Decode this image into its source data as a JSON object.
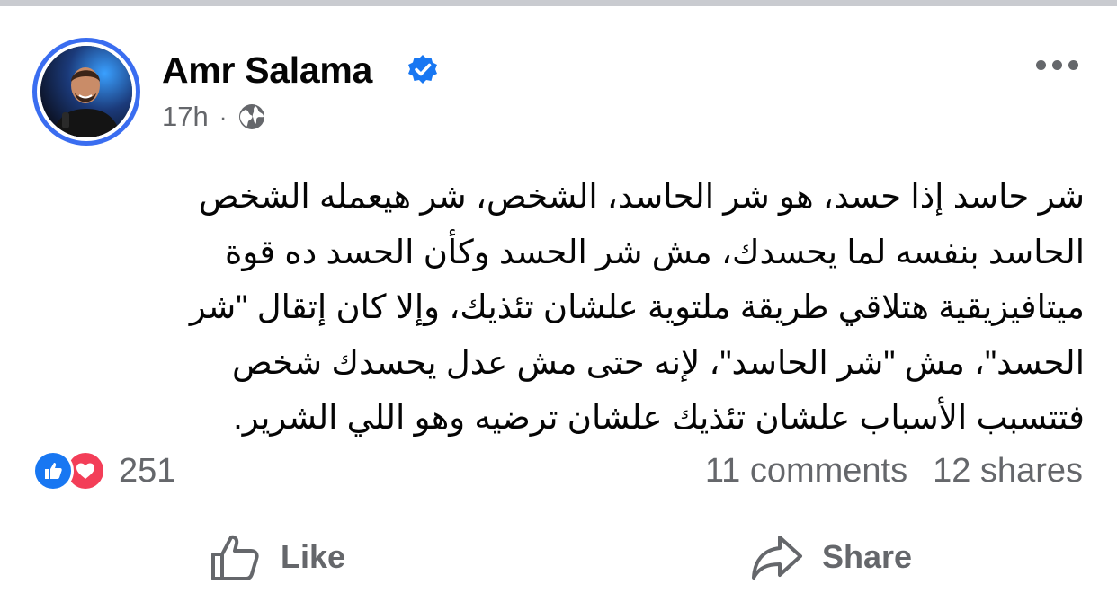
{
  "colors": {
    "accent": "#1877f2",
    "love": "#f33e58",
    "muted": "#65676b",
    "ring": "#3a6df0"
  },
  "post": {
    "author": "Amr Salama",
    "verified_icon": "verified-badge-icon",
    "time": "17h",
    "separator": "·",
    "privacy_icon": "globe-icon",
    "text_lines": [
      "شر حاسد إذا حسد، هو شر الحاسد، الشخص، شر هيعمله الشخص",
      "الحاسد بنفسه لما يحسدك، مش شر الحسد وكأن الحسد ده قوة",
      "ميتافيزيقية هتلاقي طريقة ملتوية علشان تئذيك، وإلا كان إتقال \"شر",
      "الحسد\"، مش \"شر الحاسد\"، لإنه حتى مش عدل يحسدك شخص",
      "فتتسبب الأسباب علشان تئذيك علشان ترضيه وهو اللي الشرير."
    ]
  },
  "reactions": {
    "icons": [
      "like-reaction-icon",
      "love-reaction-icon"
    ],
    "count": "251"
  },
  "stats": {
    "comments": "11 comments",
    "shares": "12 shares"
  },
  "actions": {
    "like_label": "Like",
    "share_label": "Share"
  }
}
